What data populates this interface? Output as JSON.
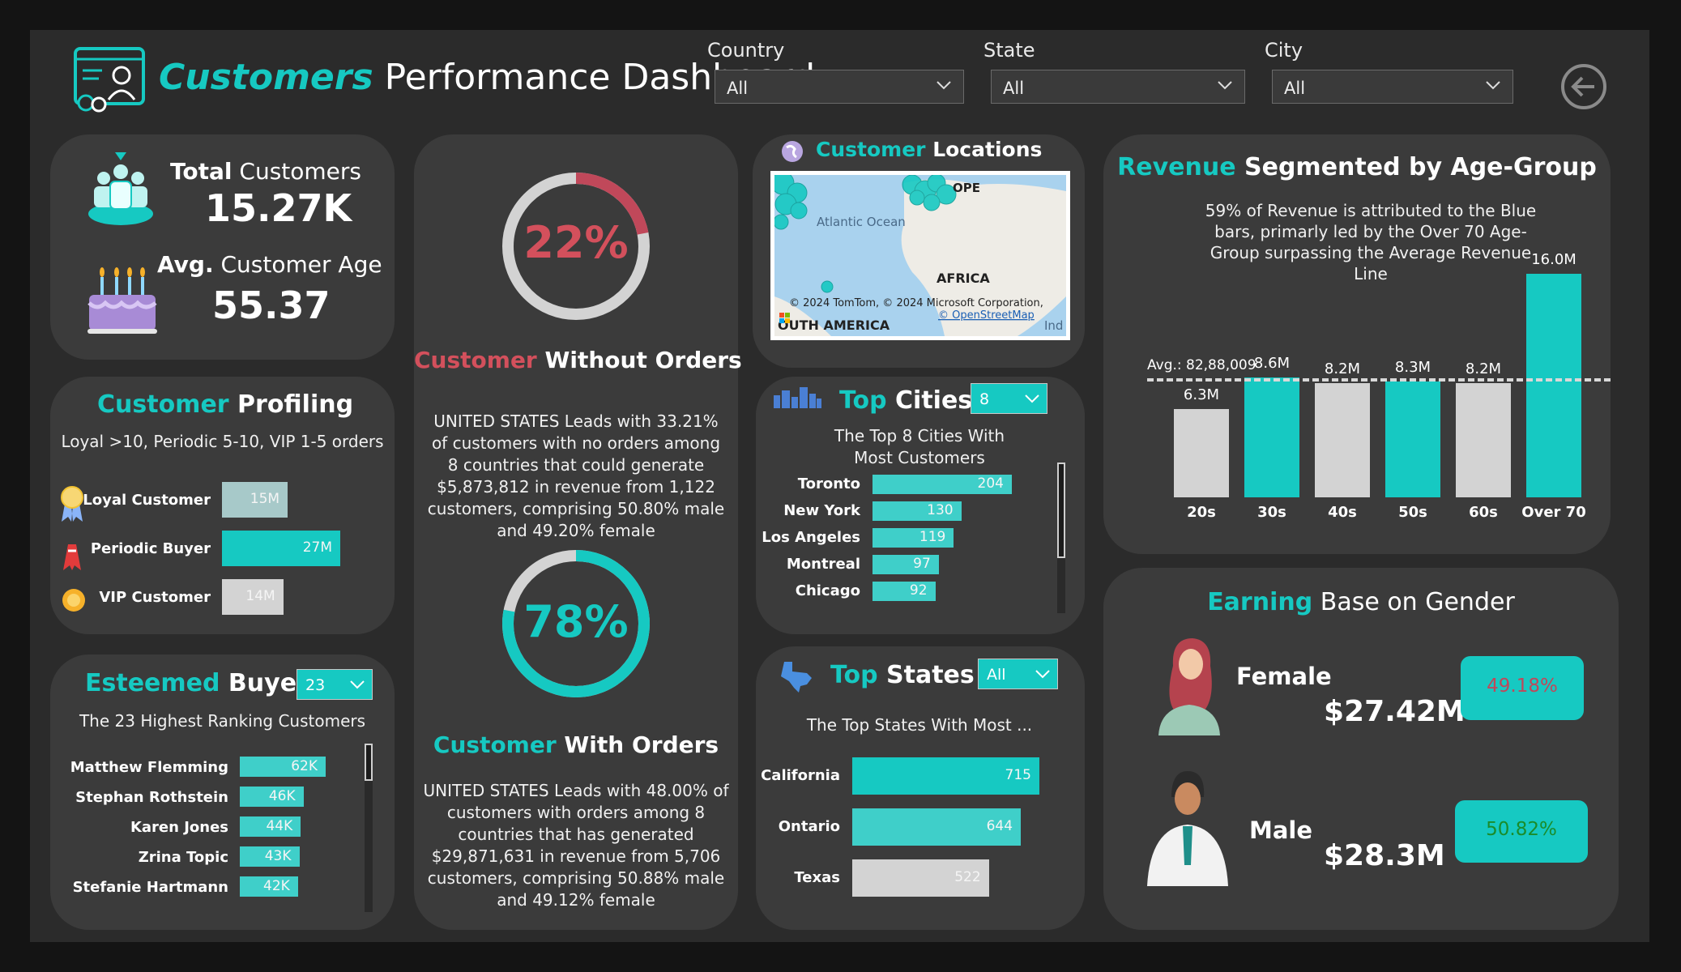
{
  "header": {
    "title_accent": "Customers",
    "title_rest": " Performance Dashboard",
    "filters": [
      {
        "label": "Country",
        "value": "All"
      },
      {
        "label": "State",
        "value": "All"
      },
      {
        "label": "City",
        "value": "All"
      }
    ]
  },
  "kpi": {
    "total_customers_bold": "Total",
    "total_customers_rest": " Customers",
    "total_customers_value": "15.27K",
    "avg_age_bold": "Avg.",
    "avg_age_rest": " Customer Age",
    "avg_age_value": "55.37"
  },
  "profiling": {
    "title_accent": "Customer",
    "title_rest": " Profiling",
    "subtitle": "Loyal >10, Periodic 5-10,  VIP 1-5 orders",
    "bars": [
      {
        "label": "Loyal Customer",
        "value": 15,
        "display": "15M",
        "color": "#a7c9c9"
      },
      {
        "label": "Periodic Buyer",
        "value": 27,
        "display": "27M",
        "color": "#16c9c2"
      },
      {
        "label": "VIP Customer",
        "value": 14,
        "display": "14M",
        "color": "#d3d3d3"
      }
    ]
  },
  "esteemed": {
    "title_accent": "Esteemed",
    "title_rest": " Buyers",
    "selector": "23",
    "subtitle": "The 23 Highest Ranking Customers",
    "bars": [
      {
        "label": "Matthew Flemming",
        "value": 62,
        "display": "62K"
      },
      {
        "label": "Stephan Rothstein",
        "value": 46,
        "display": "46K"
      },
      {
        "label": "Karen Jones",
        "value": 44,
        "display": "44K"
      },
      {
        "label": "Zrina Topic",
        "value": 43,
        "display": "43K"
      },
      {
        "label": "Stefanie Hartmann",
        "value": 42,
        "display": "42K"
      }
    ]
  },
  "without_orders": {
    "percent": "22%",
    "fraction": 0.22,
    "title_accent": "Customer",
    "title_rest": " Without Orders",
    "text": "UNITED STATES Leads with 33.21% of customers with no orders among 8 countries that could generate $5,873,812 in revenue from 1,122 customers, comprising 50.80% male and 49.20% female"
  },
  "with_orders": {
    "percent": "78%",
    "fraction": 0.78,
    "title_accent": "Customer",
    "title_rest": " With Orders",
    "text": "UNITED STATES Leads with 48.00% of customers with orders among 8 countries that has generated $29,871,631 in revenue from 5,706 customers, comprising 50.88% male and 49.12% female"
  },
  "locations": {
    "title_accent": "Customer",
    "title_rest": " Locations",
    "map_labels": {
      "atlantic": "Atlantic Ocean",
      "africa": "AFRICA",
      "europe": "OPE",
      "samerica": "OUTH AMERICA",
      "ind": "Ind"
    },
    "attribution": "© 2024 TomTom, © 2024 Microsoft Corporation,",
    "osm": "© OpenStreetMap"
  },
  "top_cities": {
    "title_accent": "Top",
    "title_rest": " Cities",
    "selector": "8",
    "subtitle": "The Top 8 Cities With Most Customers",
    "bars": [
      {
        "label": "Toronto",
        "value": 204
      },
      {
        "label": "New York",
        "value": 130
      },
      {
        "label": "Los Angeles",
        "value": 119
      },
      {
        "label": "Montreal",
        "value": 97
      },
      {
        "label": "Chicago",
        "value": 92
      }
    ]
  },
  "top_states": {
    "title_accent": "Top",
    "title_rest": " States",
    "selector": "All",
    "subtitle": "The Top  States With Most ...",
    "bars": [
      {
        "label": "California",
        "value": 715,
        "color": "#16c9c2"
      },
      {
        "label": "Ontario",
        "value": 644,
        "color": "#3fcfc9"
      },
      {
        "label": "Texas",
        "value": 522,
        "color": "#d3d3d3"
      }
    ]
  },
  "revenue_age": {
    "title_accent": "Revenue",
    "title_rest": " Segmented by Age-Group",
    "note": "59% of Revenue is attributed to the Blue bars, primarly led by the Over 70 Age-Group surpassing the Average Revenue Line",
    "avg_label": "Avg.: 82,88,009"
  },
  "gender": {
    "title_accent": "Earning",
    "title_rest": " Base on Gender",
    "female_label": "Female",
    "female_value": "$27.42M",
    "female_pct": "49.18%",
    "male_label": "Male",
    "male_value": "$28.3M",
    "male_pct": "50.82%"
  },
  "chart_data": {
    "type": "bar",
    "categories": [
      "20s",
      "30s",
      "40s",
      "50s",
      "60s",
      "Over 70"
    ],
    "values": [
      6.3,
      8.6,
      8.2,
      8.3,
      8.2,
      16.0
    ],
    "data_labels": [
      "6.3M",
      "8.6M",
      "8.2M",
      "8.3M",
      "8.2M",
      "16.0M"
    ],
    "colors": [
      "#d3d3d3",
      "#16c9c2",
      "#d3d3d3",
      "#16c9c2",
      "#d3d3d3",
      "#16c9c2"
    ],
    "average": 8.288009,
    "ylim": [
      0,
      16.0
    ],
    "title": "Revenue Segmented by Age-Group",
    "xlabel": "",
    "ylabel": ""
  }
}
